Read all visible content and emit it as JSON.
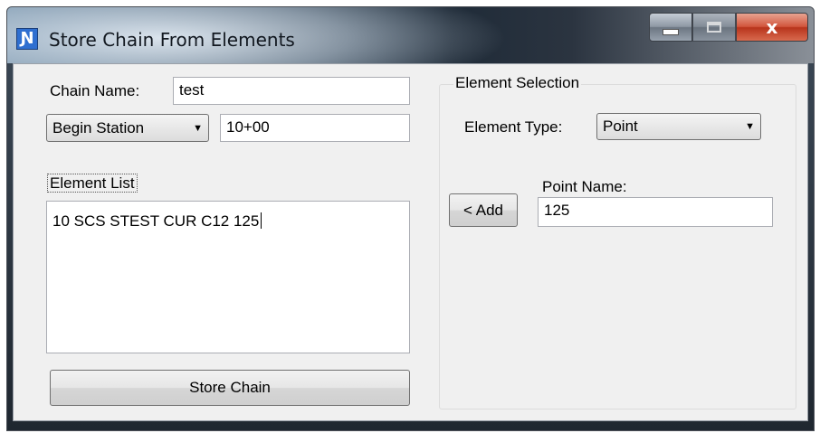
{
  "window": {
    "title": "Store Chain From Elements",
    "icon": "app-icon",
    "buttons": {
      "minimize": "minimize-icon",
      "maximize": "maximize-icon",
      "close": "x"
    }
  },
  "chain_name": {
    "label": "Chain Name:",
    "value": "test"
  },
  "station": {
    "selected": "Begin Station",
    "value": "10+00"
  },
  "element_list": {
    "label": "Element List",
    "value": "10 SCS STEST CUR C12 125"
  },
  "store_button": "Store Chain",
  "element_selection": {
    "title": "Element Selection",
    "type_label": "Element Type:",
    "type_selected": "Point",
    "point_name_label": "Point Name:",
    "point_name_value": "125",
    "add_button": "< Add"
  }
}
